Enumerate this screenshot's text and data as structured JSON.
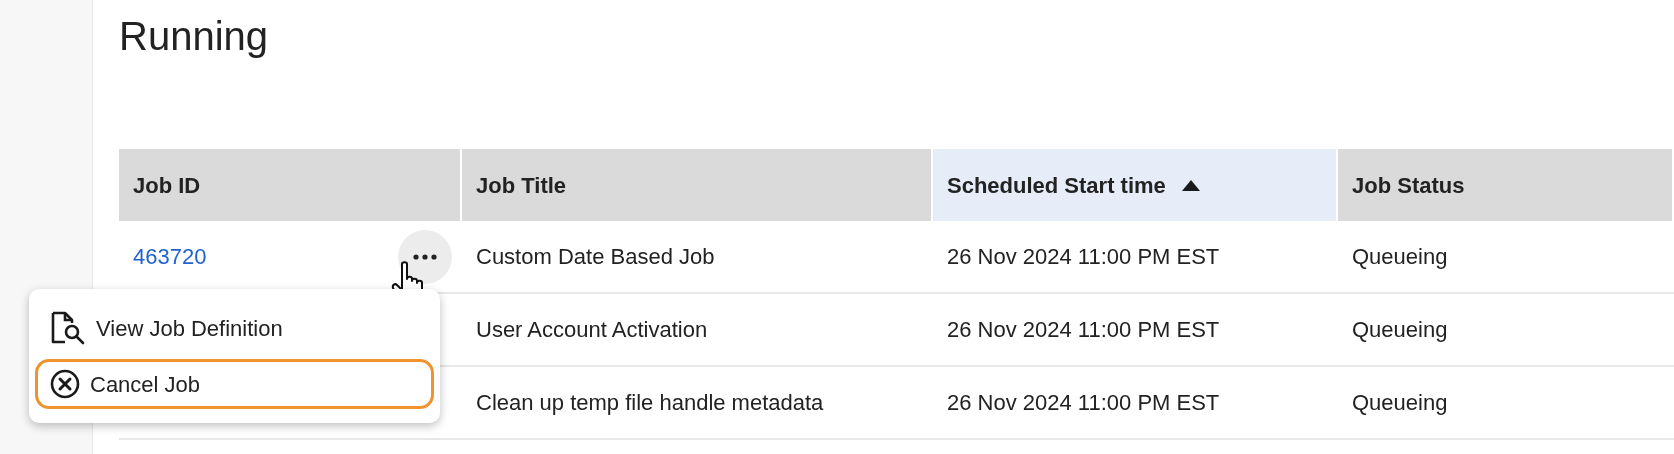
{
  "page": {
    "title": "Running"
  },
  "table": {
    "columns": [
      {
        "label": "Job ID",
        "sorted": false
      },
      {
        "label": "Job Title",
        "sorted": false
      },
      {
        "label": "Scheduled Start time",
        "sorted": true
      },
      {
        "label": "Job Status",
        "sorted": false
      }
    ],
    "rows": [
      {
        "job_id": "463720",
        "menu_button": true,
        "job_title": "Custom Date Based Job",
        "start_time": "26 Nov 2024 11:00 PM EST",
        "status": "Queueing"
      },
      {
        "menu_button": false,
        "job_title": "User Account Activation",
        "start_time": "26 Nov 2024 11:00 PM EST",
        "status": "Queueing"
      },
      {
        "menu_button": false,
        "job_title": "Clean up temp file handle metadata",
        "start_time": "26 Nov 2024 11:00 PM EST",
        "status": "Queueing"
      }
    ]
  },
  "actions_menu": {
    "items": [
      {
        "kind": "view",
        "label": "View Job Definition",
        "focused": false
      },
      {
        "kind": "cancel",
        "label": "Cancel Job",
        "focused": true
      }
    ]
  }
}
